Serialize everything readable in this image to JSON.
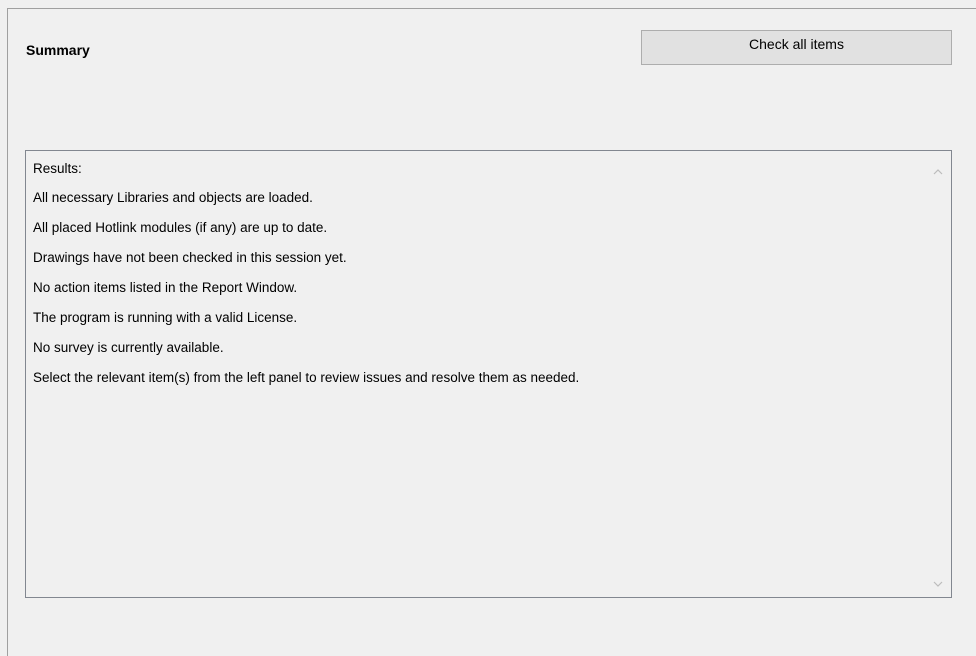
{
  "panel": {
    "title": "Summary",
    "check_button_label": "Check all items"
  },
  "results": {
    "lines": [
      "Results:",
      "All necessary Libraries and objects are loaded.",
      "All placed Hotlink modules (if any) are up to date.",
      "Drawings have not been checked in this session yet.",
      "No action items listed in the Report Window.",
      "The program is running with a valid License.",
      "No survey is currently available.",
      "Select the relevant item(s) from the left panel to review issues and resolve them as needed."
    ]
  },
  "scrollbar": {
    "up_icon": "chevron-up-icon",
    "down_icon": "chevron-down-icon"
  }
}
